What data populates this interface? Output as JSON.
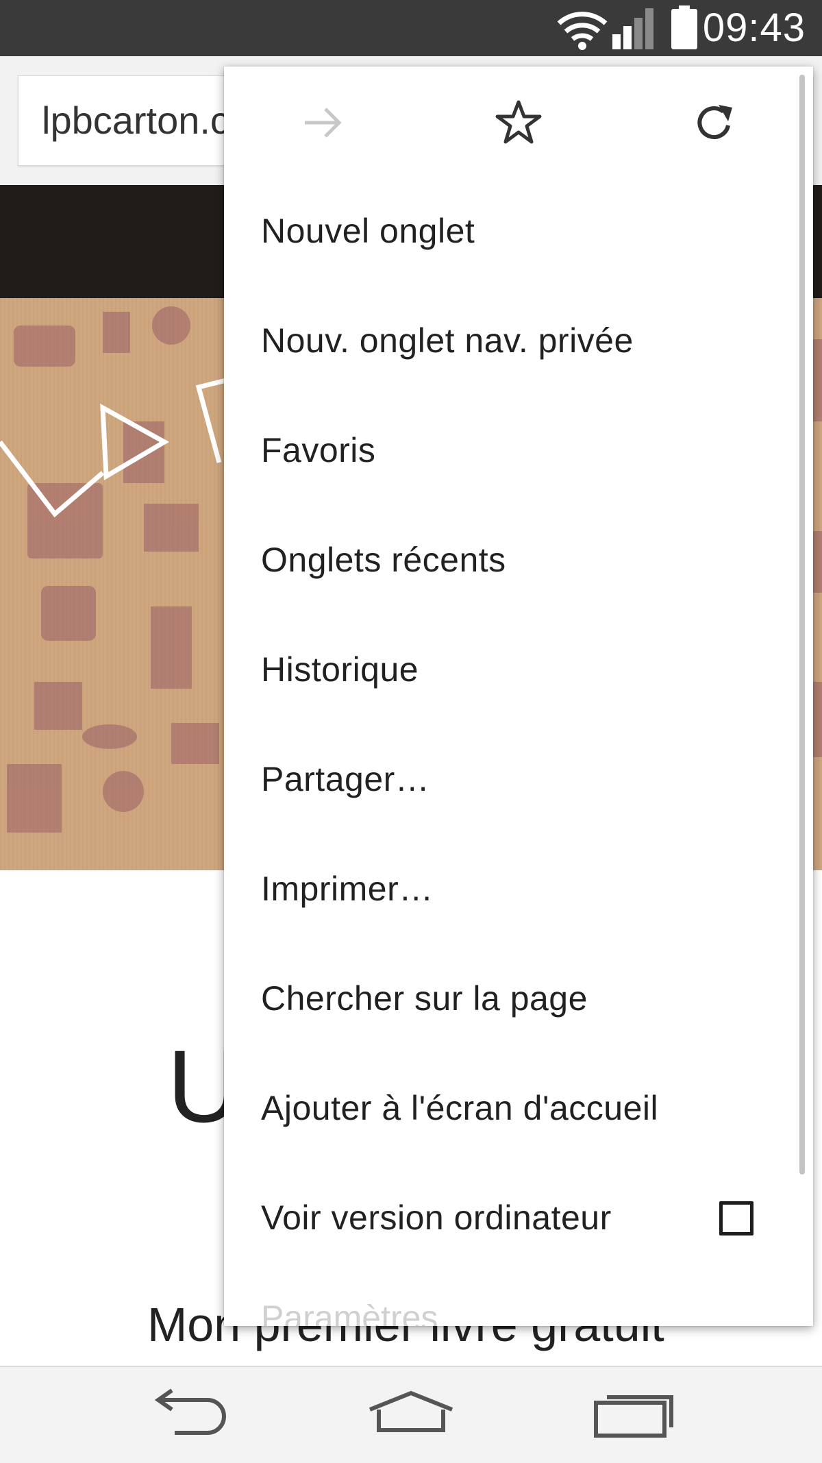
{
  "status_bar": {
    "time": "09:43",
    "icons": [
      "wifi-icon",
      "signal-icon",
      "battery-icon"
    ]
  },
  "toolbar": {
    "url_text": "lpbcarton.c"
  },
  "page": {
    "big_letter": "U",
    "bottom_heading": "Mon premier livre gratuit"
  },
  "menu": {
    "icons": [
      "forward-arrow-icon",
      "star-icon",
      "reload-icon"
    ],
    "items": [
      {
        "label": "Nouvel onglet"
      },
      {
        "label": "Nouv. onglet nav. privée"
      },
      {
        "label": "Favoris"
      },
      {
        "label": "Onglets récents"
      },
      {
        "label": "Historique"
      },
      {
        "label": "Partager…"
      },
      {
        "label": "Imprimer…"
      },
      {
        "label": "Chercher sur la page"
      },
      {
        "label": "Ajouter à l'écran d'accueil"
      },
      {
        "label": "Voir version ordinateur",
        "checked": false
      }
    ],
    "partial_item_label": "Paramètres"
  },
  "navbar": {
    "icons": [
      "back-icon",
      "home-icon",
      "recent-apps-icon"
    ]
  },
  "colors": {
    "status_bar": "#3a3a3a",
    "site_header": "#201c1a",
    "hero_background": "#cfa77f",
    "hero_pattern": "#9a5f66"
  }
}
